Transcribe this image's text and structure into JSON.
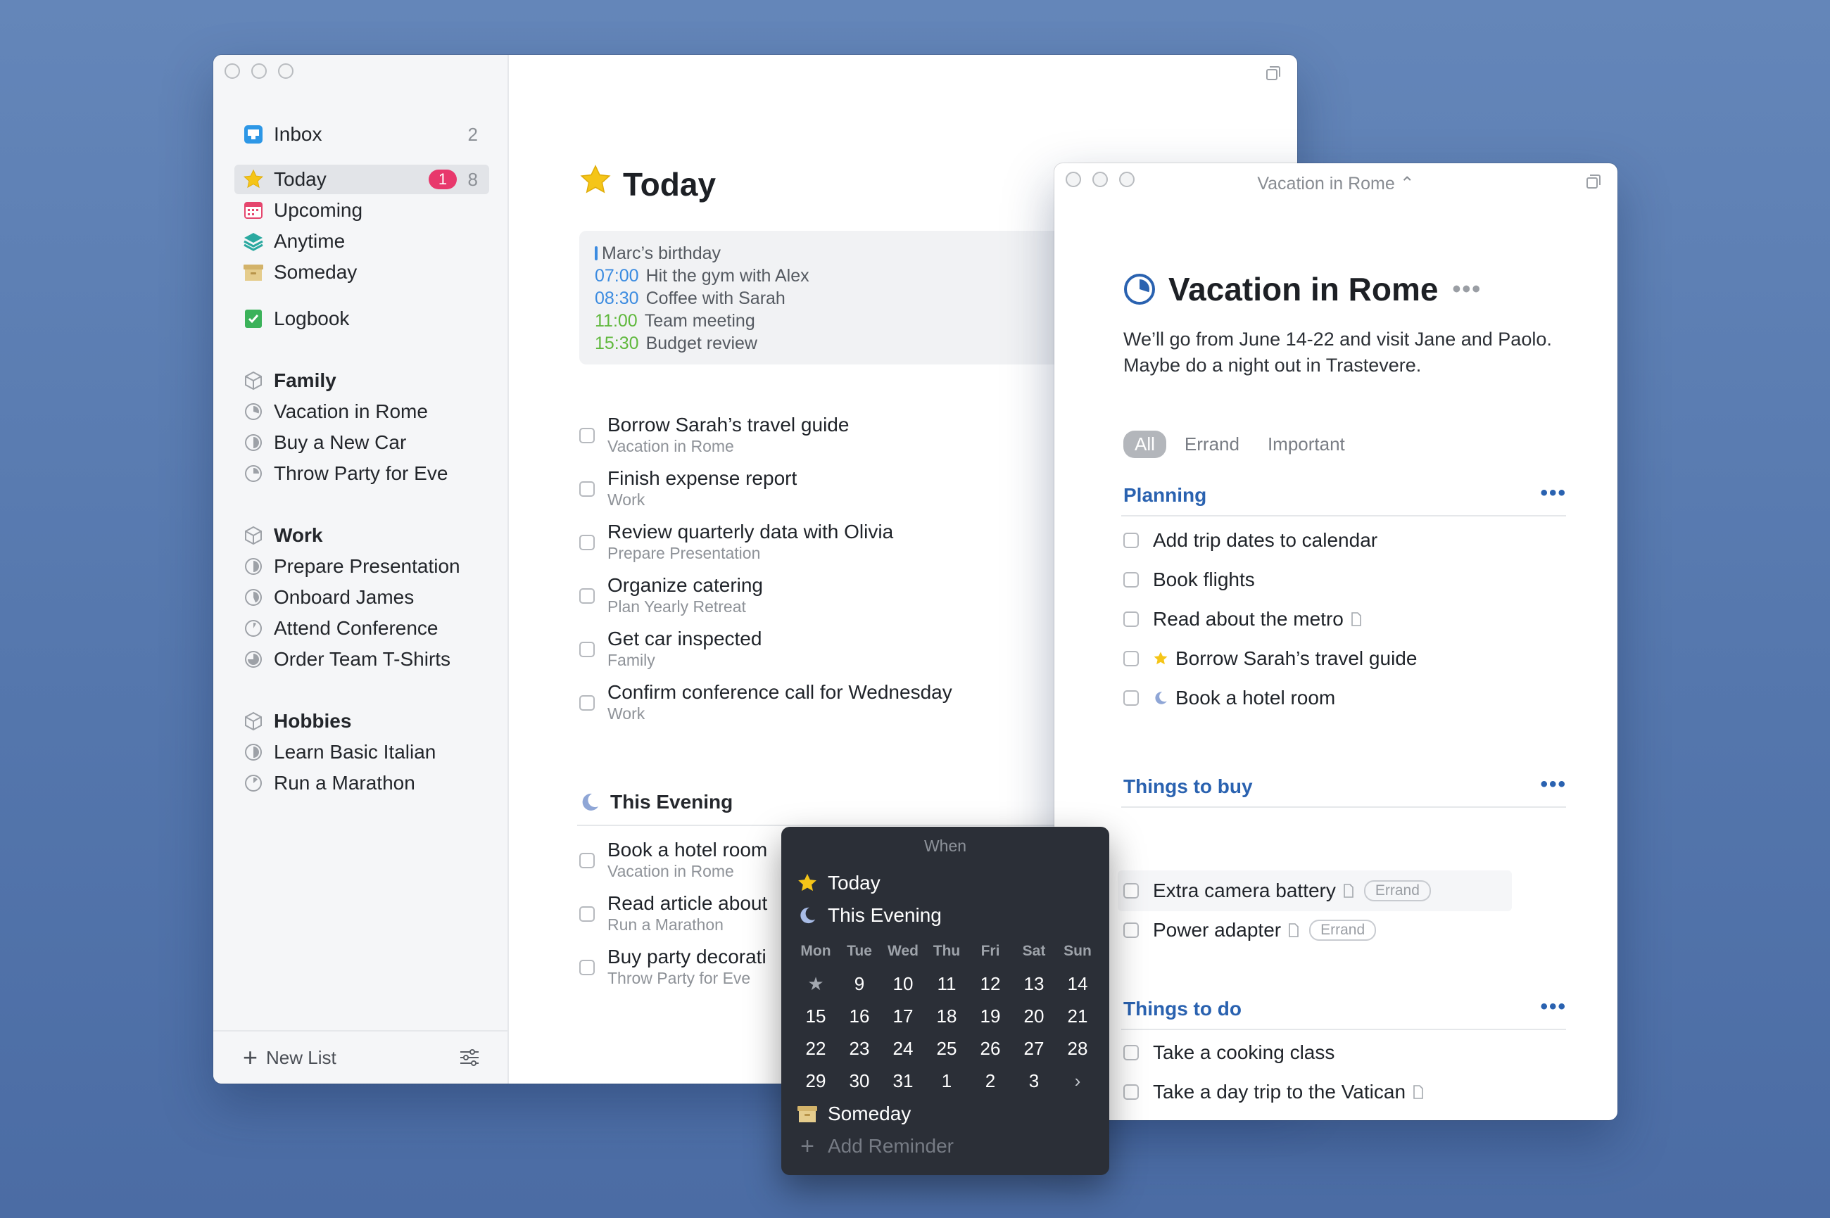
{
  "sidebar": {
    "inbox": {
      "label": "Inbox",
      "count": "2"
    },
    "today": {
      "label": "Today",
      "badge": "1",
      "count": "8"
    },
    "upcoming": {
      "label": "Upcoming"
    },
    "anytime": {
      "label": "Anytime"
    },
    "someday": {
      "label": "Someday"
    },
    "logbook": {
      "label": "Logbook"
    },
    "areas": [
      {
        "name": "Family",
        "projects": [
          "Vacation in Rome",
          "Buy a New Car",
          "Throw Party for Eve"
        ]
      },
      {
        "name": "Work",
        "projects": [
          "Prepare Presentation",
          "Onboard James",
          "Attend Conference",
          "Order Team T-Shirts"
        ]
      },
      {
        "name": "Hobbies",
        "projects": [
          "Learn Basic Italian",
          "Run a Marathon"
        ]
      }
    ],
    "new_list": "New List"
  },
  "today": {
    "title": "Today",
    "calendar": [
      {
        "time": "",
        "text": "Marc’s birthday"
      },
      {
        "time": "07:00",
        "text": "Hit the gym with Alex"
      },
      {
        "time": "08:30",
        "text": "Coffee with Sarah"
      },
      {
        "time": "11:00",
        "text": "Team meeting"
      },
      {
        "time": "15:30",
        "text": "Budget review"
      }
    ],
    "tasks": [
      {
        "title": "Borrow Sarah’s travel guide",
        "sub": "Vacation in Rome"
      },
      {
        "title": "Finish expense report",
        "sub": "Work"
      },
      {
        "title": "Review quarterly data with Olivia",
        "sub": "Prepare Presentation"
      },
      {
        "title": "Organize catering",
        "sub": "Plan Yearly Retreat"
      },
      {
        "title": "Get car inspected",
        "sub": "Family"
      },
      {
        "title": "Confirm conference call for Wednesday",
        "sub": "Work"
      }
    ],
    "evening_title": "This Evening",
    "evening_tasks": [
      {
        "title": "Book a hotel room",
        "sub": "Vacation in Rome"
      },
      {
        "title": "Read article about",
        "sub": "Run a Marathon"
      },
      {
        "title": "Buy party decorati",
        "sub": "Throw Party for Eve"
      }
    ]
  },
  "project": {
    "window_title": "Vacation in Rome ⌃",
    "title": "Vacation in Rome",
    "more": "•••",
    "notes": "We’ll go from June 14-22 and visit Jane and Paolo. Maybe do a night out in Trastevere.",
    "tags": [
      "All",
      "Errand",
      "Important"
    ],
    "headings": [
      {
        "title": "Planning",
        "more": "•••",
        "tasks": [
          "Add trip dates to calendar",
          "Book flights",
          "Read about the metro",
          "Borrow Sarah’s travel guide",
          "Book a hotel room"
        ]
      },
      {
        "title": "Things to buy",
        "more": "•••",
        "tasks": [
          "Extra camera battery",
          "Power adapter"
        ],
        "tag": "Errand"
      },
      {
        "title": "Things to do",
        "more": "•••",
        "tasks": [
          "Take a cooking class",
          "Take a day trip to the Vatican"
        ]
      }
    ]
  },
  "when": {
    "title": "When",
    "today": "Today",
    "evening": "This Evening",
    "days": [
      "Mon",
      "Tue",
      "Wed",
      "Thu",
      "Fri",
      "Sat",
      "Sun"
    ],
    "dates": [
      "★",
      "9",
      "10",
      "11",
      "12",
      "13",
      "14",
      "15",
      "16",
      "17",
      "18",
      "19",
      "20",
      "21",
      "22",
      "23",
      "24",
      "25",
      "26",
      "27",
      "28",
      "29",
      "30",
      "31",
      "1",
      "2",
      "3",
      "›"
    ],
    "someday": "Someday",
    "add_reminder": "Add Reminder"
  },
  "colors": {
    "accent": "#2a62b0",
    "badge": "#e8386c",
    "star": "#f5c518",
    "popover": "#2b2f37"
  }
}
